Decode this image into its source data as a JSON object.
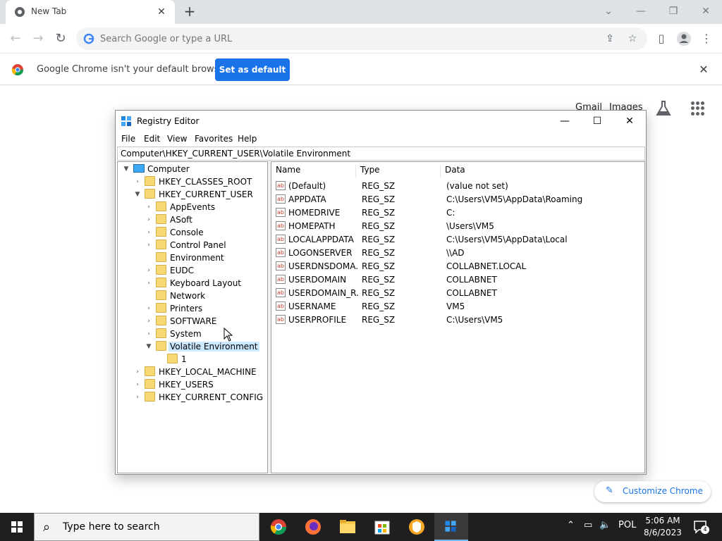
{
  "browser": {
    "tab_title": "New Tab",
    "omnibox_placeholder": "Search Google or type a URL",
    "infobar_text": "Google Chrome isn't your default browser",
    "infobar_button": "Set as default",
    "ntp_gmail": "Gmail",
    "ntp_images": "Images",
    "customize_label": "Customize Chrome"
  },
  "regedit": {
    "title": "Registry Editor",
    "menu": [
      "File",
      "Edit",
      "View",
      "Favorites",
      "Help"
    ],
    "address": "Computer\\HKEY_CURRENT_USER\\Volatile Environment",
    "tree": {
      "computer": "Computer",
      "hkcr": "HKEY_CLASSES_ROOT",
      "hkcu": "HKEY_CURRENT_USER",
      "hkcu_children": [
        "AppEvents",
        "ASoft",
        "Console",
        "Control Panel",
        "Environment",
        "EUDC",
        "Keyboard Layout",
        "Network",
        "Printers",
        "SOFTWARE",
        "System",
        "Volatile Environment"
      ],
      "volatile_child": "1",
      "hklm": "HKEY_LOCAL_MACHINE",
      "hku": "HKEY_USERS",
      "hkcc": "HKEY_CURRENT_CONFIG"
    },
    "columns": {
      "name": "Name",
      "type": "Type",
      "data": "Data"
    },
    "icon_text": "ab",
    "values": [
      {
        "name": "(Default)",
        "type": "REG_SZ",
        "data": "(value not set)"
      },
      {
        "name": "APPDATA",
        "type": "REG_SZ",
        "data": "C:\\Users\\VM5\\AppData\\Roaming"
      },
      {
        "name": "HOMEDRIVE",
        "type": "REG_SZ",
        "data": "C:"
      },
      {
        "name": "HOMEPATH",
        "type": "REG_SZ",
        "data": "\\Users\\VM5"
      },
      {
        "name": "LOCALAPPDATA",
        "type": "REG_SZ",
        "data": "C:\\Users\\VM5\\AppData\\Local"
      },
      {
        "name": "LOGONSERVER",
        "type": "REG_SZ",
        "data": "\\\\AD"
      },
      {
        "name": "USERDNSDOMA...",
        "type": "REG_SZ",
        "data": "COLLABNET.LOCAL"
      },
      {
        "name": "USERDOMAIN",
        "type": "REG_SZ",
        "data": "COLLABNET"
      },
      {
        "name": "USERDOMAIN_R...",
        "type": "REG_SZ",
        "data": "COLLABNET"
      },
      {
        "name": "USERNAME",
        "type": "REG_SZ",
        "data": "VM5"
      },
      {
        "name": "USERPROFILE",
        "type": "REG_SZ",
        "data": "C:\\Users\\VM5"
      }
    ]
  },
  "taskbar": {
    "search_placeholder": "Type here to search",
    "language": "POL",
    "time": "5:06 AM",
    "date": "8/6/2023",
    "notification_count": "4"
  },
  "colors": {
    "accent": "#1a73e8",
    "selection": "#cce8ff",
    "folder": "#f8d775",
    "taskbar": "#1f1f1f"
  }
}
